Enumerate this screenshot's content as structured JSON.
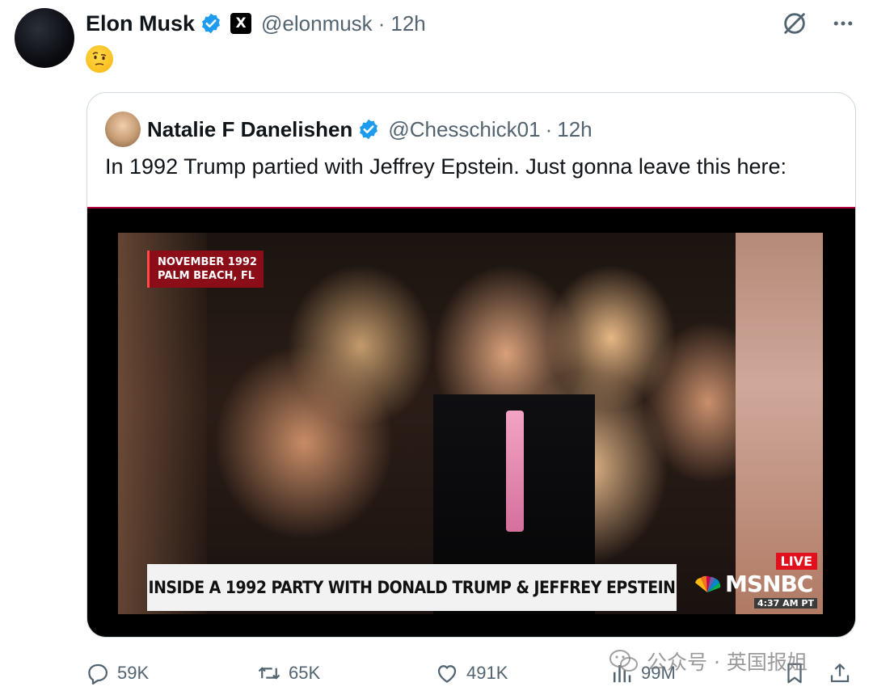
{
  "tweet": {
    "author_name": "Elon Musk",
    "handle": "@elonmusk",
    "separator": "·",
    "time": "12h",
    "x_badge": "X",
    "verified_icon": "verified-badge-icon",
    "colors": {
      "verified": "#1d9bf0",
      "secondary_text": "#536471"
    }
  },
  "quote": {
    "author_name": "Natalie F Danelishen",
    "handle": "@Chesschick01",
    "separator": "·",
    "time": "12h",
    "text": "In 1992 Trump partied with Jeffrey Epstein. Just gonna leave this here:"
  },
  "video": {
    "date_line1": "NOVEMBER 1992",
    "date_line2": "PALM BEACH, FL",
    "chyron": "INSIDE A 1992 PARTY WITH DONALD TRUMP & JEFFREY EPSTEIN",
    "live_label": "LIVE",
    "network": "MSNBC",
    "clock": "4:37 AM PT"
  },
  "actions": {
    "replies": "59K",
    "reposts": "65K",
    "likes": "491K",
    "views": "99M"
  },
  "watermark": {
    "text": "公众号 · 英国报姐"
  }
}
